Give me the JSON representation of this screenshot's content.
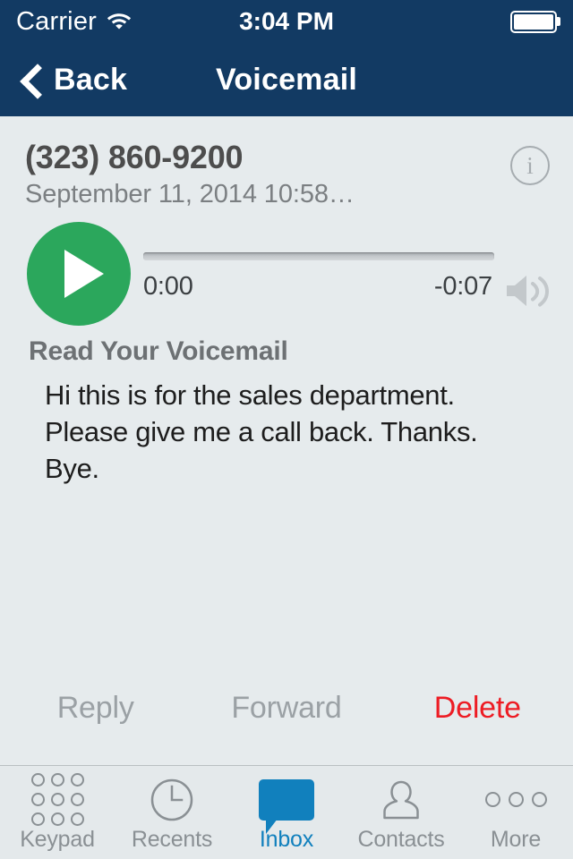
{
  "status_bar": {
    "carrier": "Carrier",
    "wifi_icon": "wifi-icon",
    "time": "3:04 PM",
    "battery_icon": "battery-full-icon"
  },
  "nav_bar": {
    "back_label": "Back",
    "back_icon": "chevron-left-icon",
    "title": "Voicemail"
  },
  "voicemail": {
    "caller_number": "(323) 860-9200",
    "date": "September 11, 2014 10:58…",
    "info_icon": "info-circle-icon",
    "info_icon_glyph": "i",
    "play_icon": "play-icon",
    "elapsed_time": "0:00",
    "remaining_time": "-0:07",
    "speaker_icon": "speaker-volume-icon",
    "progress_percent": 0,
    "transcript_heading": "Read Your Voicemail",
    "transcript_text": "Hi this is for the sales department. Please give me a call back. Thanks. Bye."
  },
  "actions": [
    {
      "label": "Reply",
      "state": "disabled"
    },
    {
      "label": "Forward",
      "state": "disabled"
    },
    {
      "label": "Delete",
      "state": "destructive"
    }
  ],
  "tab_bar": [
    {
      "label": "Keypad",
      "icon": "keypad-grid-icon",
      "active": false
    },
    {
      "label": "Recents",
      "icon": "clock-icon",
      "active": false
    },
    {
      "label": "Inbox",
      "icon": "speech-bubble-icon",
      "active": true
    },
    {
      "label": "Contacts",
      "icon": "person-icon",
      "active": false
    },
    {
      "label": "More",
      "icon": "ellipsis-icon",
      "active": false
    }
  ],
  "colors": {
    "nav_background": "#123a63",
    "page_background": "#e6ebed",
    "play_button_green": "#2ba75c",
    "active_tab_blue": "#1180bd",
    "delete_red": "#ed1c24",
    "disabled_gray": "#9ba1a5"
  }
}
